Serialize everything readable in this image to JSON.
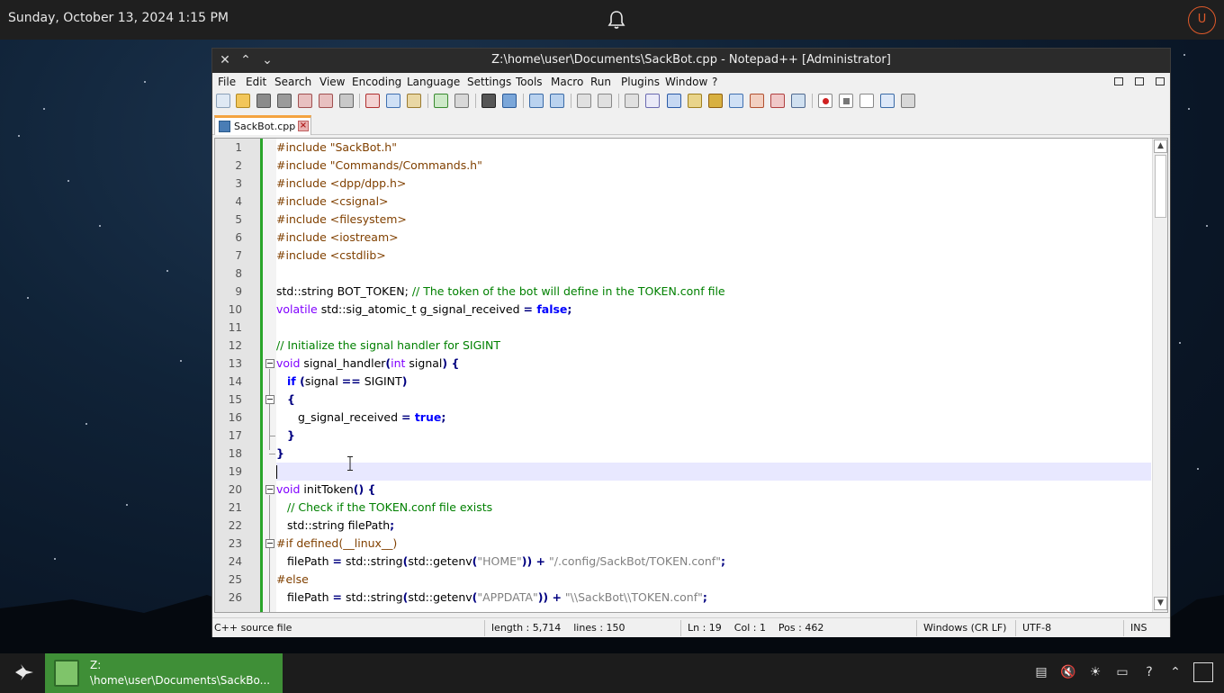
{
  "top_panel": {
    "clock": "Sunday, October 13, 2024 1:15 PM",
    "notification_icon": "bell-icon",
    "user_initial": "U"
  },
  "window": {
    "title": "Z:\\home\\user\\Documents\\SackBot.cpp - Notepad++ [Administrator]",
    "menu": [
      "File",
      "Edit",
      "Search",
      "View",
      "Encoding",
      "Language",
      "Settings",
      "Tools",
      "Macro",
      "Run",
      "Plugins",
      "Window",
      "?"
    ],
    "tab": {
      "label": "SackBot.cpp"
    }
  },
  "editor": {
    "lines": [
      {
        "n": "1"
      },
      {
        "n": "2"
      },
      {
        "n": "3"
      },
      {
        "n": "4"
      },
      {
        "n": "5"
      },
      {
        "n": "6"
      },
      {
        "n": "7"
      },
      {
        "n": "8"
      },
      {
        "n": "9"
      },
      {
        "n": "10"
      },
      {
        "n": "11"
      },
      {
        "n": "12"
      },
      {
        "n": "13"
      },
      {
        "n": "14"
      },
      {
        "n": "15"
      },
      {
        "n": "16"
      },
      {
        "n": "17"
      },
      {
        "n": "18"
      },
      {
        "n": "19"
      },
      {
        "n": "20"
      },
      {
        "n": "21"
      },
      {
        "n": "22"
      },
      {
        "n": "23"
      },
      {
        "n": "24"
      },
      {
        "n": "25"
      },
      {
        "n": "26"
      }
    ],
    "code": {
      "l1": "#include \"SackBot.h\"",
      "l2": "#include \"Commands/Commands.h\"",
      "l3": "#include <dpp/dpp.h>",
      "l4": "#include <csignal>",
      "l5": "#include <filesystem>",
      "l6": "#include <iostream>",
      "l7": "#include <cstdlib>",
      "l9a": "std::string BOT_TOKEN; ",
      "l9b": "// The token of the bot will define in the TOKEN.conf file",
      "l10a": "volatile",
      "l10b": " std::sig_atomic_t g_signal_received ",
      "l10c": "=",
      "l10d": " false",
      "l10e": ";",
      "l12": "// Initialize the signal handler for SIGINT",
      "l13a": "void",
      "l13b": " signal_handler",
      "l13c": "(",
      "l13d": "int",
      "l13e": " signal",
      "l13f": ") {",
      "l14a": "if",
      "l14b": " (",
      "l14c": "signal ",
      "l14d": "==",
      "l14e": " SIGINT",
      "l14f": ")",
      "l15": "{",
      "l16a": "g_signal_received ",
      "l16b": "=",
      "l16c": " true",
      "l16d": ";",
      "l17": "}",
      "l18": "}",
      "l20a": "void",
      "l20b": " initToken",
      "l20c": "() {",
      "l21": "// Check if the TOKEN.conf file exists",
      "l22a": "std::string filePath",
      "l22b": ";",
      "l23": "#if defined(__linux__)",
      "l24a": "filePath ",
      "l24b": "=",
      "l24c": " std::string",
      "l24d": "(",
      "l24e": "std::getenv",
      "l24f": "(",
      "l24g": "\"HOME\"",
      "l24h": ")) +",
      "l24i": " \"/.config/SackBot/TOKEN.conf\"",
      "l24j": ";",
      "l25": "#else",
      "l26a": "filePath ",
      "l26b": "=",
      "l26c": " std::string",
      "l26d": "(",
      "l26e": "std::getenv",
      "l26f": "(",
      "l26g": "\"APPDATA\"",
      "l26h": ")) +",
      "l26i": " \"\\\\SackBot\\\\TOKEN.conf\"",
      "l26j": ";"
    }
  },
  "statusbar": {
    "filetype": "C++ source file",
    "length": "length : 5,714    lines : 150",
    "position": "Ln : 19    Col : 1    Pos : 462",
    "eol": "Windows (CR LF)",
    "encoding": "UTF-8",
    "mode": "INS"
  },
  "taskbar": {
    "app_label_line1": "Z:",
    "app_label_line2": "\\home\\user\\Documents\\SackBo..."
  },
  "colors": {
    "preprocessor": "#804000",
    "comment": "#008000",
    "keyword": "#8000ff",
    "bool": "#0000ff",
    "operator": "#000080",
    "string": "#808080",
    "current_line": "#e8e8ff",
    "taskbar_active": "#3f8f37",
    "tab_accent": "#f4a340"
  }
}
